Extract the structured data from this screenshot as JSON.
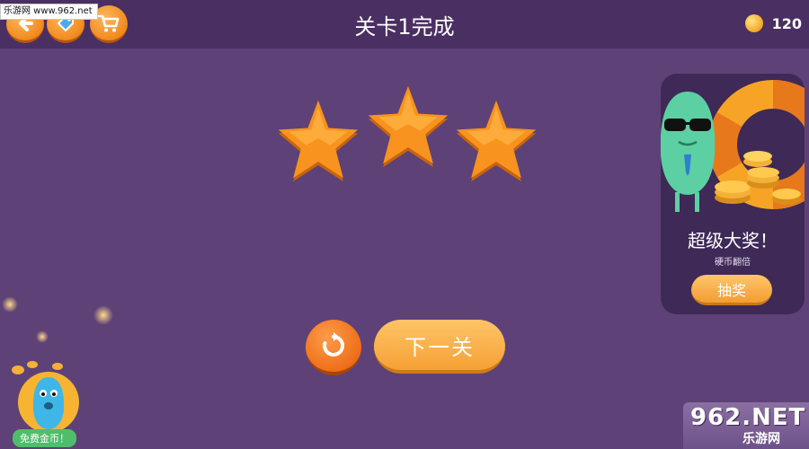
{
  "watermark_top": "乐游网 www.962.net",
  "header": {
    "title": "关卡1完成",
    "coin_count": "120",
    "back_icon": "arrow-left-icon",
    "tag_icon": "tag-icon",
    "shop_icon": "shopping-cart-icon"
  },
  "result": {
    "stars_earned": 3,
    "stars_total": 3
  },
  "actions": {
    "replay_icon": "replay-icon",
    "next_label": "下一关"
  },
  "jackpot": {
    "title": "超级大奖！",
    "subtitle": "硬币翻倍",
    "button_label": "抽奖"
  },
  "free_coins": {
    "label": "免费金币！"
  },
  "watermark_bottom": {
    "main": "962.NET",
    "sub": "乐游网"
  },
  "colors": {
    "background": "#5e4277",
    "header_bar": "#4a2f63",
    "accent_orange": "#f5a134",
    "star": "#f7931e",
    "panel": "#3e2957"
  }
}
